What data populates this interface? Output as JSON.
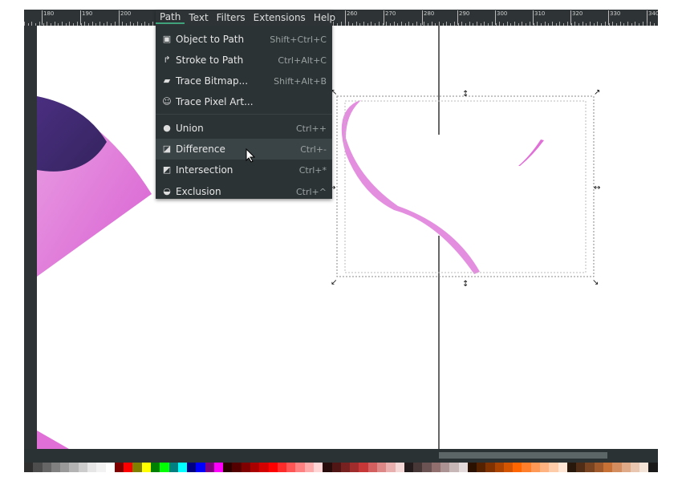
{
  "menubar": {
    "items": [
      "Path",
      "Text",
      "Filters",
      "Extensions",
      "Help"
    ],
    "active": "Path"
  },
  "path_menu": {
    "items": [
      {
        "label": "Object to Path",
        "shortcut": "Shift+Ctrl+C",
        "icon": "object-to-path-icon"
      },
      {
        "label": "Stroke to Path",
        "shortcut": "Ctrl+Alt+C",
        "icon": "stroke-to-path-icon"
      },
      {
        "label": "Trace Bitmap...",
        "shortcut": "Shift+Alt+B",
        "icon": "trace-bitmap-icon"
      },
      {
        "label": "Trace Pixel Art...",
        "shortcut": "",
        "icon": "trace-pixel-art-icon"
      },
      {
        "label": "Union",
        "shortcut": "Ctrl++",
        "icon": "union-icon"
      },
      {
        "label": "Difference",
        "shortcut": "Ctrl+-",
        "icon": "difference-icon",
        "highlighted": true
      },
      {
        "label": "Intersection",
        "shortcut": "Ctrl+*",
        "icon": "intersection-icon"
      },
      {
        "label": "Exclusion",
        "shortcut": "Ctrl+^",
        "icon": "exclusion-icon"
      }
    ]
  },
  "ruler": {
    "labels": [
      "180",
      "190",
      "200",
      "260",
      "270",
      "280",
      "290",
      "300",
      "310",
      "320",
      "330",
      "340"
    ]
  },
  "colors": {
    "accent": "#3fa27a",
    "shape_pink": "#e070d8",
    "shape_purple": "#3d2a6e"
  },
  "palette": [
    "#2e2e2e",
    "#4d4d4d",
    "#666",
    "#808080",
    "#999",
    "#b3b3b3",
    "#ccc",
    "#e6e6e6",
    "#f2f2f2",
    "#fff",
    "#800000",
    "#ff0000",
    "#808000",
    "#ffff00",
    "#008000",
    "#00ff00",
    "#008080",
    "#00ffff",
    "#000080",
    "#0000ff",
    "#800080",
    "#ff00ff",
    "#2b0000",
    "#550000",
    "#800000",
    "#aa0000",
    "#d40000",
    "#ff0000",
    "#ff2a2a",
    "#ff5555",
    "#ff8080",
    "#ffaaaa",
    "#ffd5d5",
    "#280b0b",
    "#501616",
    "#782121",
    "#a02c2c",
    "#c83737",
    "#d35f5f",
    "#de8787",
    "#e9afaf",
    "#f4d7d7",
    "#241c1c",
    "#483737",
    "#6c5353",
    "#916f6f",
    "#ac9393",
    "#c8b7b7",
    "#e3dbdb",
    "#2b1100",
    "#552200",
    "#803300",
    "#aa4400",
    "#d45500",
    "#ff6600",
    "#ff7f2a",
    "#ff9955",
    "#ffb380",
    "#ffccaa",
    "#ffe6d5",
    "#28170b",
    "#502d16",
    "#784421",
    "#a05a2c",
    "#c87137",
    "#d38d5f",
    "#deaa87",
    "#e9c6af",
    "#f4e3d7",
    "#1a1a1a"
  ]
}
